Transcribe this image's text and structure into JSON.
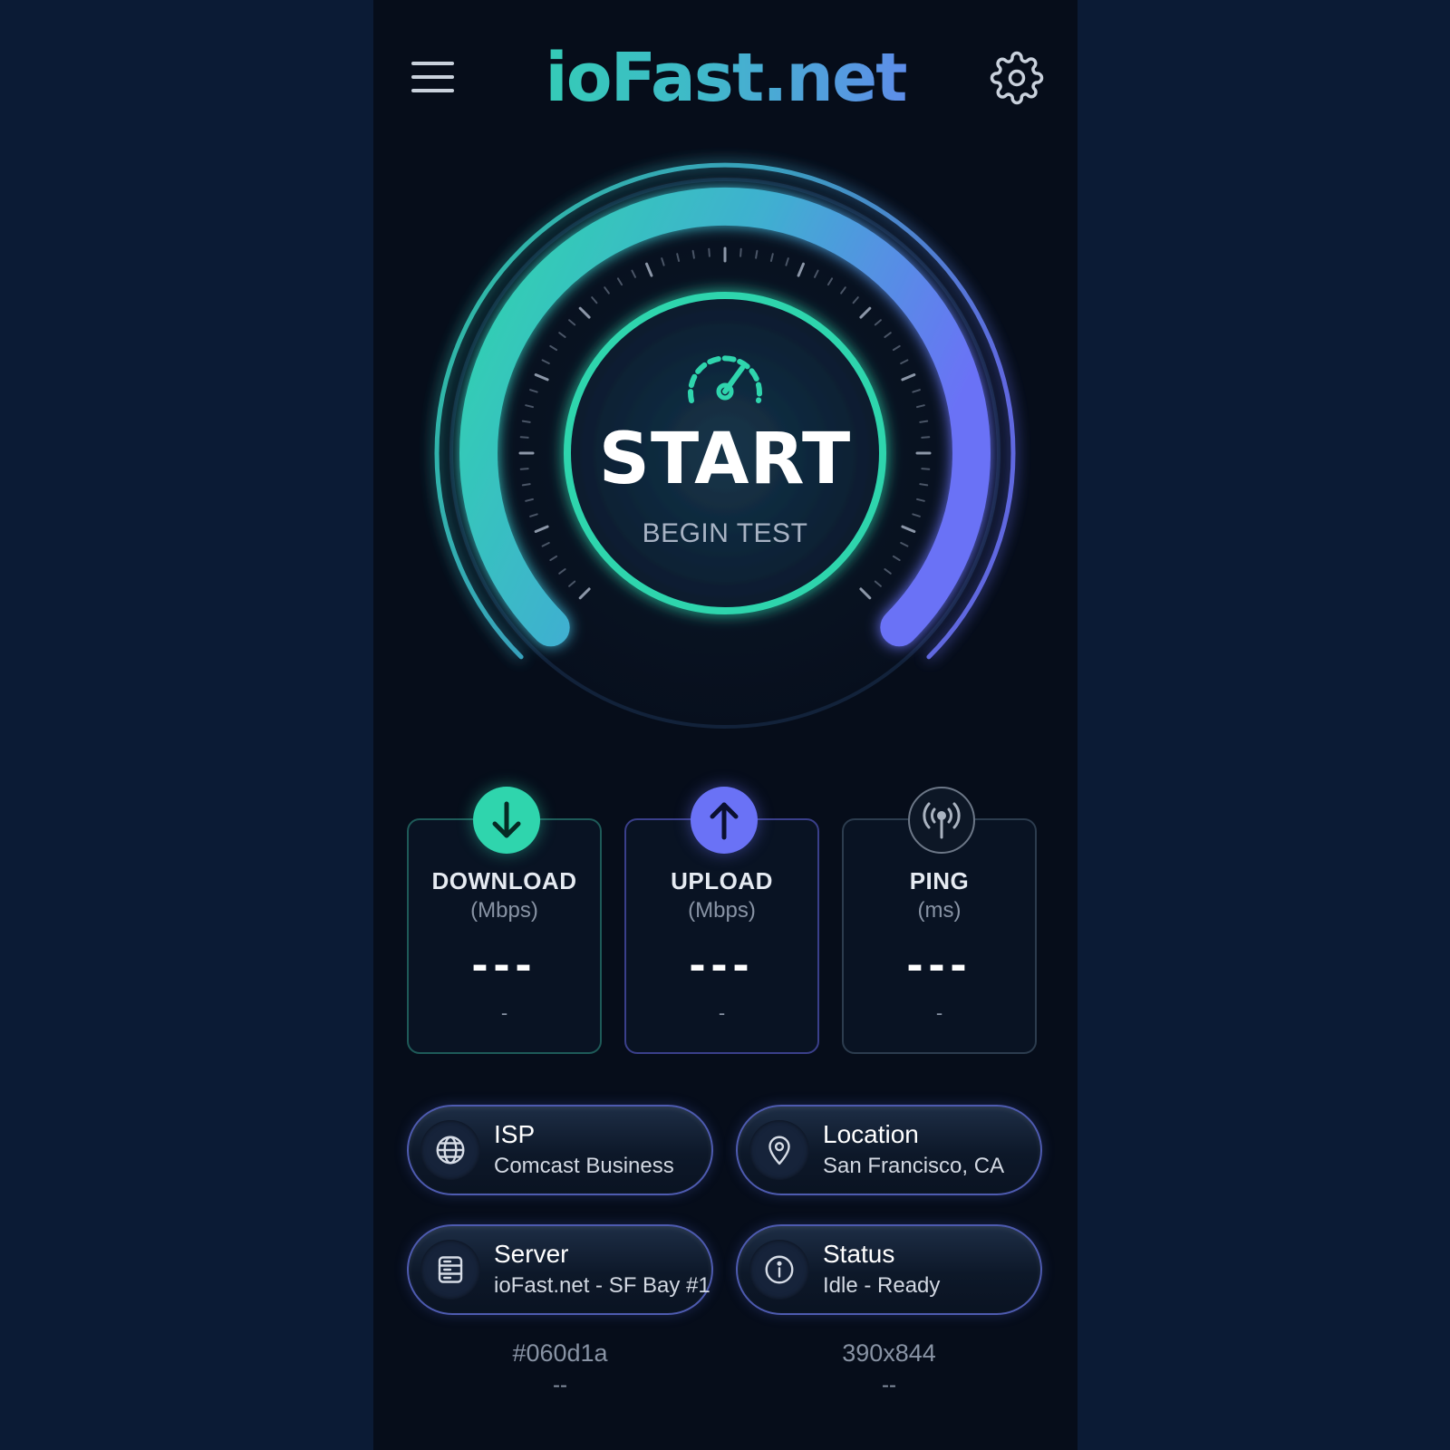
{
  "header": {
    "brand": "ioFast.net"
  },
  "gauge": {
    "start_label": "START",
    "start_sublabel": "BEGIN TEST"
  },
  "metrics": [
    {
      "title": "DOWNLOAD",
      "unit": "(Mbps)",
      "value": "---",
      "sub": "-",
      "icon": "arrow-down-icon",
      "color": "#2fd5ad"
    },
    {
      "title": "UPLOAD",
      "unit": "(Mbps)",
      "value": "---",
      "sub": "-",
      "icon": "arrow-up-icon",
      "color": "#6a72f6"
    },
    {
      "title": "PING",
      "unit": "(ms)",
      "value": "---",
      "sub": "-",
      "icon": "antenna-icon",
      "color": "#6c7787"
    }
  ],
  "info": {
    "isp": {
      "label": "ISP",
      "value": "Comcast Business",
      "icon": "globe-icon"
    },
    "location": {
      "label": "Location",
      "value": "San Francisco, CA",
      "icon": "location-pin-icon"
    },
    "server": {
      "label": "Server",
      "value": "ioFast.net - SF Bay #1",
      "icon": "server-icon"
    },
    "status": {
      "label": "Status",
      "value": "Idle - Ready",
      "icon": "info-icon"
    }
  },
  "footer": [
    {
      "main": "#060d1a",
      "sub": "--"
    },
    {
      "main": "390x844",
      "sub": "--"
    }
  ],
  "colors": {
    "background": "#060d1a",
    "accent_teal": "#2fd5ad",
    "accent_indigo": "#6a72f6"
  }
}
